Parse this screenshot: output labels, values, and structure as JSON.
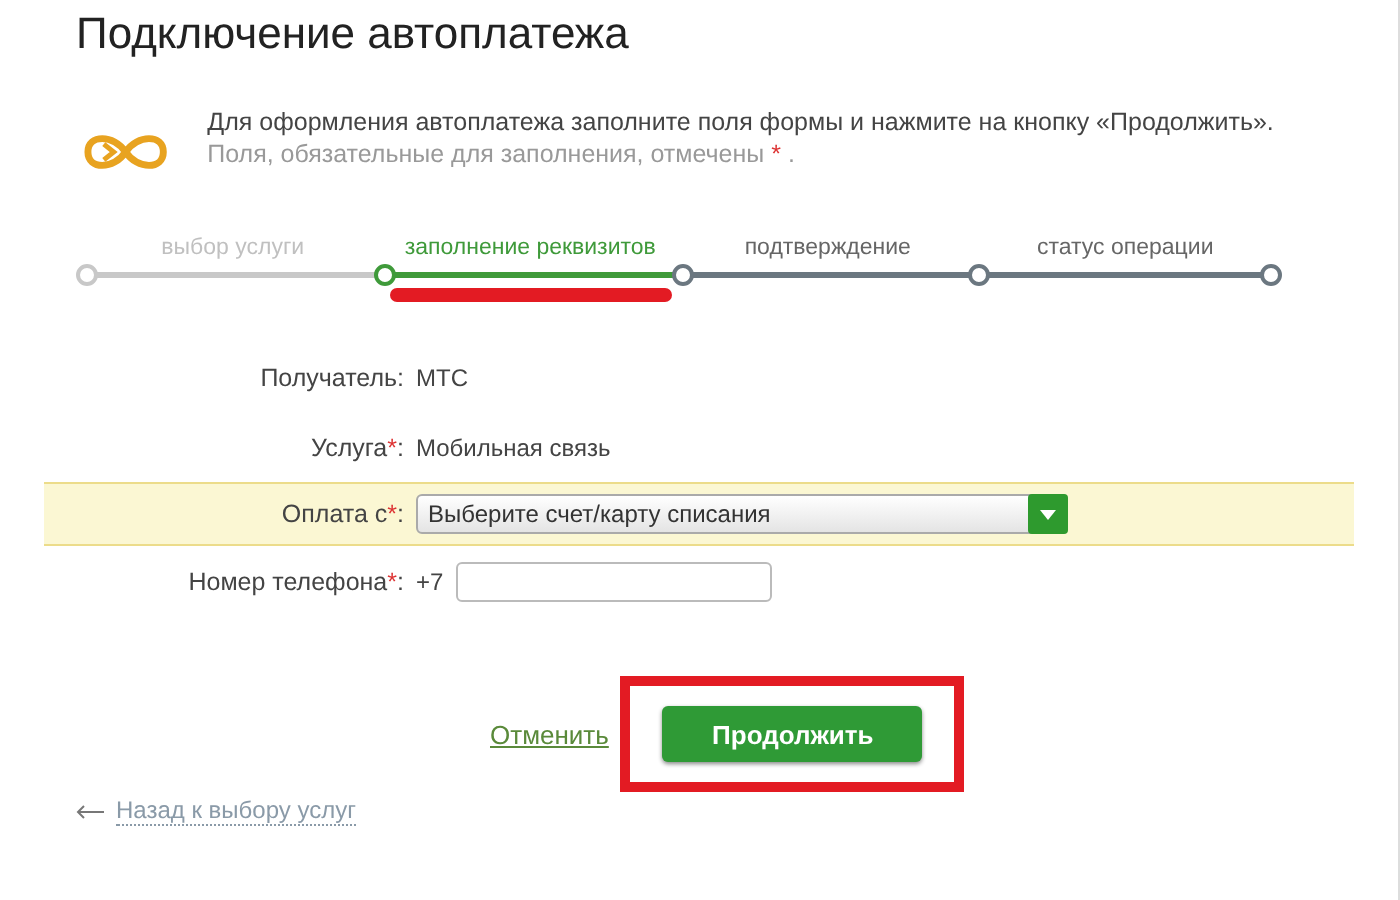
{
  "title": "Подключение автоплатежа",
  "info": {
    "text": "Для оформления автоплатежа заполните поля формы и нажмите на кнопку «Продолжить».",
    "note": "Поля, обязательные для заполнения, отмечены",
    "note_mark": "*",
    "note_end": "."
  },
  "steps": [
    {
      "label": "выбор услуги",
      "selected": false,
      "highlighted": false
    },
    {
      "label": "заполнение реквизитов",
      "selected": true,
      "highlighted": true
    },
    {
      "label": "подтверждение",
      "selected": false,
      "highlighted": false
    },
    {
      "label": "статус операции",
      "selected": false,
      "highlighted": false
    }
  ],
  "fields": [
    {
      "kind": "text",
      "label": "Получатель",
      "required": false,
      "colon": ":",
      "value": "МТС",
      "highlighted": false
    },
    {
      "kind": "text",
      "label": "Услуга",
      "required": true,
      "colon": ":",
      "value": "Мобильная связь",
      "highlighted": false
    },
    {
      "kind": "select",
      "label": "Оплата с",
      "required": true,
      "colon": ":",
      "value": "Выберите счет/карту списания",
      "highlighted": true
    },
    {
      "kind": "phone",
      "label": "Номер телефона",
      "required": true,
      "colon": ":",
      "prefix": "+7",
      "highlighted": false
    }
  ],
  "cancel": "Отменить",
  "submit": {
    "label": "Продолжить",
    "highlighted": true
  },
  "back": "Назад к выбору услуг"
}
